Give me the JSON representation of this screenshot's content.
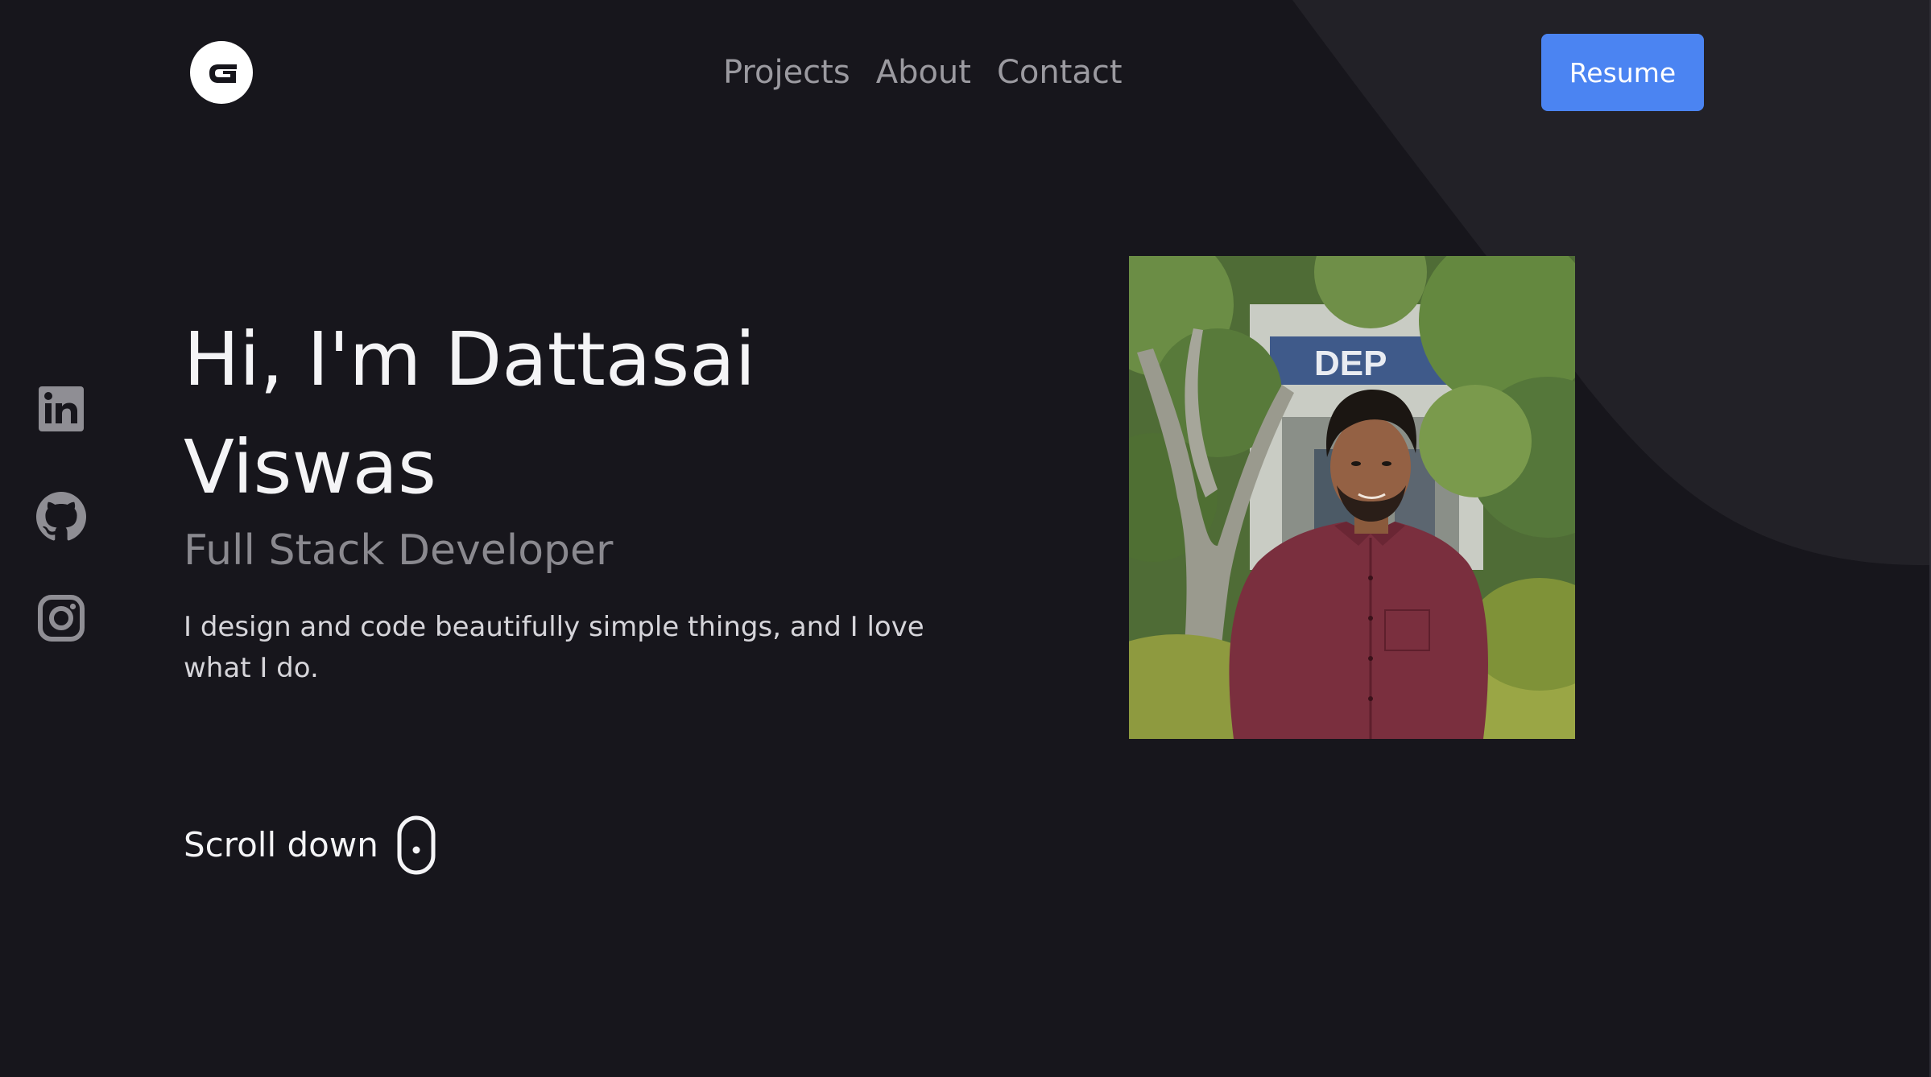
{
  "header": {
    "logo_letter": "G",
    "nav": [
      {
        "label": "Projects"
      },
      {
        "label": "About"
      },
      {
        "label": "Contact"
      }
    ],
    "resume_label": "Resume"
  },
  "social": [
    {
      "icon": "linkedin-icon"
    },
    {
      "icon": "github-icon"
    },
    {
      "icon": "instagram-icon"
    }
  ],
  "hero": {
    "title": "Hi, I'm Dattasai Viswas",
    "subtitle": "Full Stack Developer",
    "description": "I design and code beautifully simple things, and I love what I do.",
    "scroll_label": "Scroll down"
  },
  "photo": {
    "sign_text": "DEP"
  },
  "colors": {
    "background": "#17161c",
    "bg_shape": "#222127",
    "accent": "#4b84f2",
    "nav_text": "#9b9aa0",
    "subtitle_text": "#8a898f",
    "icon": "#8f8e94"
  }
}
